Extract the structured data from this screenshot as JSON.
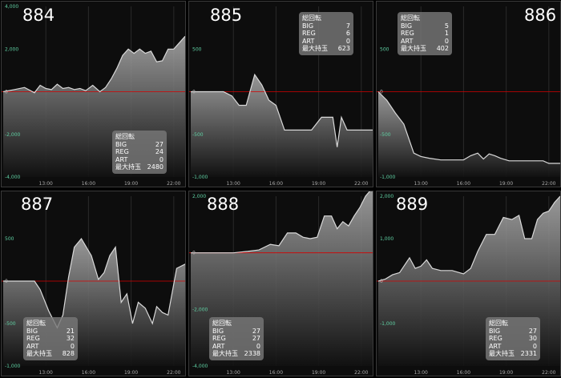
{
  "stat_labels": {
    "title": "総回転",
    "big": "BIG",
    "reg": "REG",
    "art": "ART",
    "max": "最大持玉"
  },
  "colors": {
    "background": "#000000",
    "line": "#d9d9d9",
    "zero_line": "#d40000",
    "y_tick": "#5fd0a3",
    "area_top": "#b0b0b0"
  },
  "chart_data": [
    {
      "type": "area",
      "machine": "884",
      "x_ticks": [
        "13:00",
        "16:00",
        "19:00",
        "22:00"
      ],
      "y_ticks": [
        "4,000",
        "2,000",
        "0",
        "-2,000",
        "-4,000"
      ],
      "ylim": [
        -4000,
        4000
      ],
      "xlim": [
        10,
        22.8
      ],
      "grid": true,
      "legend": "none",
      "x": [
        10,
        10.8,
        11.5,
        12.2,
        12.6,
        13.0,
        13.4,
        13.8,
        14.2,
        14.6,
        15.0,
        15.4,
        15.8,
        16.3,
        16.8,
        17.2,
        17.6,
        18.0,
        18.4,
        18.8,
        19.2,
        19.6,
        20.0,
        20.4,
        20.8,
        21.2,
        21.6,
        22.0,
        22.4,
        22.8
      ],
      "y": [
        0,
        100,
        200,
        -50,
        300,
        150,
        100,
        350,
        150,
        200,
        100,
        150,
        50,
        300,
        0,
        200,
        600,
        1100,
        1700,
        2000,
        1800,
        2000,
        1800,
        1900,
        1400,
        1450,
        2000,
        2000,
        2300,
        2600
      ],
      "stats": {
        "big": "27",
        "reg": "24",
        "art": "0",
        "max": "2480"
      }
    },
    {
      "type": "area",
      "machine": "885",
      "x_ticks": [
        "13:00",
        "16:00",
        "19:00",
        "22:00"
      ],
      "y_ticks": [
        "500",
        "0",
        "-500",
        "-1,000"
      ],
      "ylim": [
        -1000,
        1000
      ],
      "xlim": [
        10,
        22.8
      ],
      "grid": true,
      "legend": "none",
      "x": [
        10,
        11.3,
        12.3,
        12.9,
        13.4,
        13.9,
        14.5,
        15.0,
        15.5,
        16.0,
        16.6,
        17.2,
        17.8,
        18.5,
        19.2,
        20.0,
        20.3,
        20.6,
        21.0,
        21.4,
        22.0,
        22.8
      ],
      "y": [
        0,
        0,
        0,
        -50,
        -160,
        -160,
        200,
        80,
        -100,
        -160,
        -450,
        -450,
        -450,
        -450,
        -300,
        -300,
        -650,
        -300,
        -450,
        -450,
        -450,
        -450
      ],
      "stats": {
        "big": "7",
        "reg": "6",
        "art": "0",
        "max": "623"
      }
    },
    {
      "type": "area",
      "machine": "886",
      "x_ticks": [
        "13:00",
        "16:00",
        "19:00",
        "22:00"
      ],
      "y_ticks": [
        "500",
        "0",
        "-500",
        "-1,000"
      ],
      "ylim": [
        -1000,
        1000
      ],
      "xlim": [
        10,
        22.8
      ],
      "grid": true,
      "legend": "none",
      "x": [
        10,
        10.6,
        11.2,
        11.8,
        12.5,
        13.0,
        13.6,
        14.4,
        15.2,
        16.0,
        16.5,
        17.0,
        17.4,
        17.8,
        18.2,
        18.6,
        19.2,
        20.0,
        20.8,
        21.6,
        22.0,
        22.8
      ],
      "y": [
        0,
        -100,
        -250,
        -380,
        -720,
        -760,
        -780,
        -800,
        -800,
        -800,
        -750,
        -720,
        -790,
        -730,
        -750,
        -780,
        -810,
        -810,
        -810,
        -810,
        -840,
        -840
      ],
      "stats": {
        "big": "5",
        "reg": "1",
        "art": "0",
        "max": "402"
      }
    },
    {
      "type": "area",
      "machine": "887",
      "x_ticks": [
        "13:00",
        "16:00",
        "19:00",
        "22:00"
      ],
      "y_ticks": [
        "500",
        "0",
        "-500",
        "-1,000"
      ],
      "ylim": [
        -1000,
        1000
      ],
      "xlim": [
        10,
        22.8
      ],
      "grid": true,
      "legend": "none",
      "x": [
        10,
        10.8,
        11.6,
        12.2,
        12.6,
        13.2,
        13.8,
        14.2,
        14.6,
        15.0,
        15.5,
        16.2,
        16.7,
        17.1,
        17.5,
        17.9,
        18.3,
        18.7,
        19.1,
        19.5,
        20.0,
        20.5,
        20.8,
        21.2,
        21.6,
        22.2,
        22.8
      ],
      "y": [
        0,
        0,
        0,
        0,
        -100,
        -350,
        -550,
        -400,
        50,
        400,
        500,
        300,
        20,
        100,
        300,
        400,
        -250,
        -150,
        -500,
        -250,
        -320,
        -500,
        -300,
        -370,
        -400,
        150,
        200,
        -400
      ],
      "stats": {
        "big": "21",
        "reg": "32",
        "art": "0",
        "max": "828"
      }
    },
    {
      "type": "area",
      "machine": "888",
      "x_ticks": [
        "13:00",
        "16:00",
        "19:00",
        "22:00"
      ],
      "y_ticks": [
        "2,000",
        "0",
        "-2,000",
        "-4,000"
      ],
      "ylim": [
        -4000,
        2000
      ],
      "xlim": [
        10,
        22.8
      ],
      "grid": true,
      "legend": "none",
      "x": [
        10,
        11.0,
        12.0,
        13.0,
        14.0,
        14.8,
        15.6,
        16.2,
        16.8,
        17.4,
        17.9,
        18.4,
        18.9,
        19.4,
        19.9,
        20.3,
        20.7,
        21.1,
        21.5,
        21.9,
        22.3,
        22.8
      ],
      "y": [
        0,
        0,
        0,
        0,
        50,
        100,
        300,
        250,
        700,
        700,
        550,
        500,
        550,
        1300,
        1300,
        850,
        1100,
        950,
        1300,
        1600,
        2000,
        2300
      ],
      "stats": {
        "big": "27",
        "reg": "27",
        "art": "0",
        "max": "2338"
      }
    },
    {
      "type": "area",
      "machine": "889",
      "x_ticks": [
        "13:00",
        "16:00",
        "19:00",
        "22:00"
      ],
      "y_ticks": [
        "2,000",
        "1,000",
        "0",
        "-1,000"
      ],
      "ylim": [
        -2000,
        2000
      ],
      "xlim": [
        10,
        22.8
      ],
      "grid": true,
      "legend": "none",
      "x": [
        10,
        10.5,
        11.0,
        11.5,
        12.2,
        12.6,
        13.0,
        13.4,
        13.8,
        14.4,
        15.2,
        16.0,
        16.5,
        17.0,
        17.6,
        18.2,
        18.8,
        19.4,
        19.9,
        20.3,
        20.8,
        21.2,
        21.6,
        22.0,
        22.4,
        22.8
      ],
      "y": [
        0,
        50,
        150,
        200,
        550,
        300,
        350,
        500,
        300,
        250,
        250,
        170,
        300,
        700,
        1100,
        1100,
        1500,
        1450,
        1550,
        1000,
        1000,
        1450,
        1600,
        1650,
        1850,
        2000
      ],
      "stats": {
        "big": "27",
        "reg": "30",
        "art": "0",
        "max": "2331"
      }
    }
  ]
}
